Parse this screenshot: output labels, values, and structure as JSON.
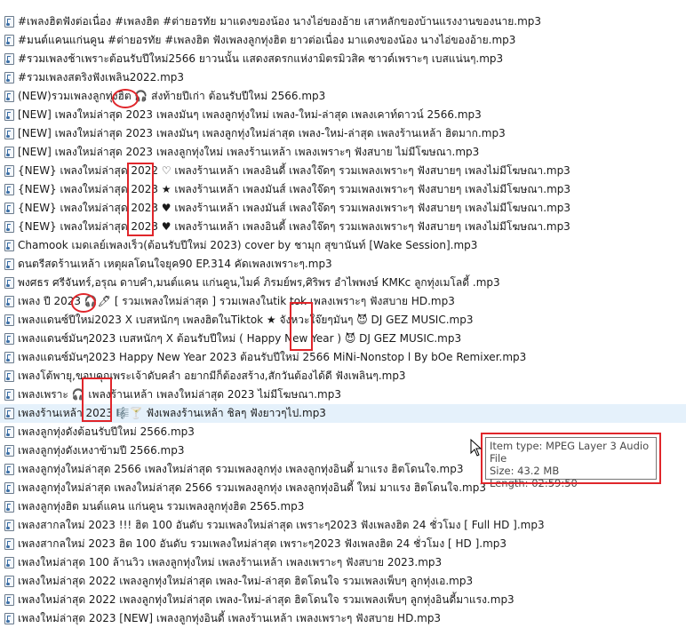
{
  "files": [
    "#เพลงฮิตฟังต่อเนื่อง #เพลงฮิต #ต่ายอรทัย มาแดงของน้อง นางไอ่ของอ้าย เสาหลักของบ้านแรงงานของนาย.mp3",
    "#มนต์แคนแก่นคูน #ต่ายอรทัย #เพลงฮิต ฟังเพลงลูกทุ่งฮิต ยาวต่อเนื่อง มาแดงของน้อง นางไอ่ของอ้าย.mp3",
    "#รวมเพลงช้าเพราะต้อนรับปีใหม่2566 ยาวนนั้น แสดงสดรกแห่งามิตรมิวสิค ซาวด์เพราะๆ เบสแน่นๆ.mp3",
    "#รวมเพลงสตริงฟังเพลิน2022.mp3",
    "(NEW)รวมเพลงลูกทุ่งฮิต 🎧 ส่งท้ายปีเก่า ต้อนรับปีใหม่ 2566.mp3",
    "[NEW] เพลงใหม่ล่าสุด 2023 เพลงมันๆ เพลงลูกทุ่งใหม่ เพลง-ใหม่-ล่าสุด เพลงเคาท์ดาวน์ 2566.mp3",
    "[NEW] เพลงใหม่ล่าสุด 2023 เพลงมันๆ เพลงลูกทุ่งใหม่ล่าสุด เพลง-ใหม่-ล่าสุด เพลงร้านเหล้า ฮิตมาก.mp3",
    "[NEW] เพลงใหม่ล่าสุด 2023 เพลงลูกทุ่งใหม่ เพลงร้านเหล้า เพลงเพราะๆ ฟังสบาย ไม่มีโฆษณา.mp3",
    "{NEW} เพลงใหม่ล่าสุด 2022 ♡ เพลงร้านเหล้า เพลงอินดี้ เพลงใจ๊ดๆ รวมเพลงเพราะๆ ฟังสบายๆ เพลงไม่มีโฆษณา.mp3",
    "{NEW} เพลงใหม่ล่าสุด 2023 ★ เพลงร้านเหล้า เพลงมันส์ เพลงใจ๊ดๆ รวมเพลงเพราะๆ ฟังสบายๆ เพลงไม่มีโฆษณา.mp3",
    "{NEW} เพลงใหม่ล่าสุด 2023 ♥ เพลงร้านเหล้า เพลงมันส์ เพลงใจ๊ดๆ รวมเพลงเพราะๆ ฟังสบายๆ เพลงไม่มีโฆษณา.mp3",
    "{NEW} เพลงใหม่ล่าสุด 2023 ♥ เพลงร้านเหล้า เพลงอินดี้ เพลงใจ๊ดๆ รวมเพลงเพราะๆ ฟังสบายๆ เพลงไม่มีโฆษณา.mp3",
    "Chamook เมดเลย์เพลงเร็ว(ต้อนรับปีใหม่ 2023) cover by ชามุก สุขานันท์ [Wake Session].mp3",
    "ดนตรีสดร้านเหล้า เหตุผลโดนใจยุค90 EP.314 คัดเพลงเพราะๆ.mp3",
    "พงศธร ศรีจันทร์,อรุณ ดาบคำ,มนต์แคน แก่นคูน,ไมค์ ภิรมย์พร,ศิริพร อำไพพงษ์ KMKc ลูกทุ่งเมโลดี้ .mp3",
    "เพลง ปี 2023 🎧🖊 [ รวมเพลงใหม่ล่าสุด ] รวมเพลงในtik tok เพลงเพราะๆ ฟังสบาย HD.mp3",
    "เพลงแดนซ์ปีใหม่2023 X เบสหนักๆ เพลงฮิตในTiktok ★ จังหวะใจ๊ยๆมันๆ 😈 DJ GEZ MUSIC.mp3",
    "เพลงแดนซ์มันๆ2023 เบสหนักๆ X ต้อนรับปีใหม่ ( Happy New Year ) 😈 DJ GEZ MUSIC.mp3",
    "เพลงแดนซ์มันๆ2023 Happy New Year 2023 ต้อนรับปีใหม่ 2566 MiNi-Nonstop l By bOe Remixer.mp3",
    "เพลงโต้พายุ,ขอบคุณพระเจ้าดับคลํา อยากมีก็ต้องสร้าง,สักวันต้องได้ดี ฟังเพลินๆ.mp3",
    "เพลงเพราะ 🎧 เพลงร้านเหล้า เพลงใหม่ล่าสุด 2023 ไม่มีโฆษณา.mp3",
    "เพลงร้านเหล้า 2023 🎼🍸 ฟังเพลงร้านเหล้า ชิลๆ ฟังยาวๆไป.mp3",
    "เพลงลูกทุ่งดังต้อนรับปีใหม่ 2566.mp3",
    "เพลงลูกทุ่งดังเหงาข้ามปี 2566.mp3",
    "เพลงลูกทุ่งใหม่ล่าสุด 2566 เพลงใหม่ล่าสุด รวมเพลงลูกทุ่ง เพลงลูกทุ่งอินดี้ มาแรง ฮิตโดนใจ.mp3",
    "เพลงลูกทุ่งใหม่ล่าสุด เพลงใหม่ล่าสุด 2566 รวมเพลงลูกทุ่ง เพลงลูกทุ่งอินดี้ ใหม่ มาแรง ฮิตโดนใจ.mp3",
    "เพลงลูกทุ่งฮิต มนต์แคน แก่นคูน รวมเพลงลูกทุ่งฮิต 2565.mp3",
    "เพลงสากลใหม่ 2023 !!! ฮิต 100 อันดับ รวมเพลงใหม่ล่าสุด เพราะๆ2023 ฟังเพลงฮิต 24 ชั่วโมง [ Full HD ].mp3",
    "เพลงสากลใหม่ 2023 ฮิต 100 อันดับ รวมเพลงใหม่ล่าสุด เพราะๆ2023 ฟังเพลงฮิต 24 ชั่วโมง [ HD ].mp3",
    "เพลงใหม่ล่าสุด 100 ล้านวิว เพลงลูกทุ่งใหม่ เพลงร้านเหล้า เพลงเพราะๆ ฟังสบาย 2023.mp3",
    "เพลงใหม่ล่าสุด 2022 เพลงลูกทุ่งใหม่ล่าสุด เพลง-ใหม่-ล่าสุด ฮิตโดนใจ รวมเพลงเพ็บๆ ลูกทุ่งเอ.mp3",
    "เพลงใหม่ล่าสุด 2022 เพลงลูกทุ่งใหม่ล่าสุด เพลง-ใหม่-ล่าสุด ฮิตโดนใจ รวมเพลงเพ็บๆ ลูกทุ่งอินดี้มาแรง.mp3",
    "เพลงใหม่ล่าสุด 2023 [NEW] เพลงลูกทุ่งอินดี้ เพลงร้านเหล้า เพลงเพราะๆ ฟังสบาย HD.mp3"
  ],
  "hover_index": 21,
  "tooltip": {
    "type": "Item type: MPEG Layer 3 Audio File",
    "size": "Size: 43.2 MB",
    "length": "Length: 02:59:50"
  },
  "colors": {
    "annotation": "#e0262b",
    "hover": "#e5f1fb",
    "text": "#1a1a1a"
  }
}
